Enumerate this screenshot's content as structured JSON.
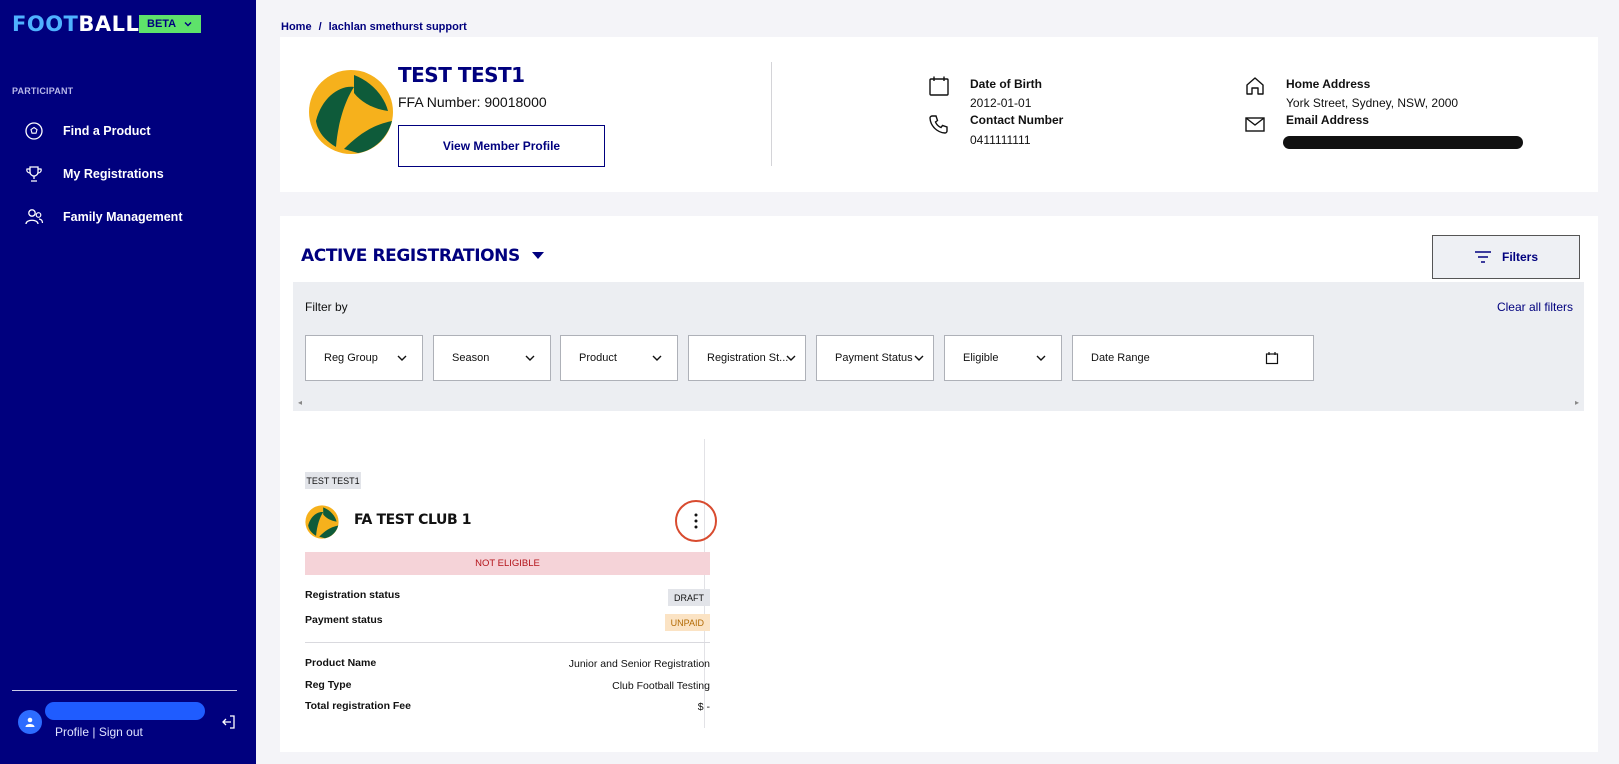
{
  "app": {
    "logo_part1": "FOOT",
    "logo_part2": "BALL",
    "beta_label": "BETA"
  },
  "sidebar": {
    "section_label": "PARTICIPANT",
    "items": [
      {
        "label": "Find a Product",
        "icon": "football-icon"
      },
      {
        "label": "My Registrations",
        "icon": "trophy-icon"
      },
      {
        "label": "Family Management",
        "icon": "family-icon"
      }
    ],
    "profile_label": "Profile",
    "separator": " | ",
    "signout_label": "Sign out"
  },
  "breadcrumb": {
    "home": "Home",
    "separator": "/",
    "current": "lachlan smethurst support"
  },
  "member": {
    "name": "TEST TEST1",
    "ffa_number": "FFA Number: 90018000",
    "view_profile_label": "View Member Profile",
    "dob_label": "Date of Birth",
    "dob_value": "2012-01-01",
    "contact_label": "Contact Number",
    "contact_value": "0411111111",
    "address_label": "Home Address",
    "address_value": "York Street, Sydney, NSW, 2000",
    "email_label": "Email Address"
  },
  "registrations": {
    "title": "ACTIVE REGISTRATIONS",
    "filters_label": "Filters",
    "filter_by_label": "Filter by",
    "clear_all_label": "Clear all filters",
    "filters": [
      {
        "label": "Reg Group"
      },
      {
        "label": "Season"
      },
      {
        "label": "Product"
      },
      {
        "label": "Registration St..."
      },
      {
        "label": "Payment Status"
      },
      {
        "label": "Eligible"
      },
      {
        "label": "Date Range"
      }
    ],
    "card": {
      "person_tag": "TEST TEST1",
      "club_name": "FA TEST CLUB 1",
      "eligibility": "NOT ELIGIBLE",
      "registration_status_label": "Registration status",
      "registration_status": "DRAFT",
      "payment_status_label": "Payment status",
      "payment_status": "UNPAID",
      "product_name_label": "Product Name",
      "product_name": "Junior and Senior Registration",
      "reg_type_label": "Reg Type",
      "reg_type": "Club Football Testing",
      "total_fee_label": "Total registration Fee",
      "total_fee": "$ -"
    }
  },
  "colors": {
    "brand_navy": "#00007e",
    "beta_green": "#5ee26a",
    "not_eligible_bg": "#f5d3d8",
    "unpaid_bg": "#fbe3c4",
    "highlight_ring": "#d84b2f"
  }
}
